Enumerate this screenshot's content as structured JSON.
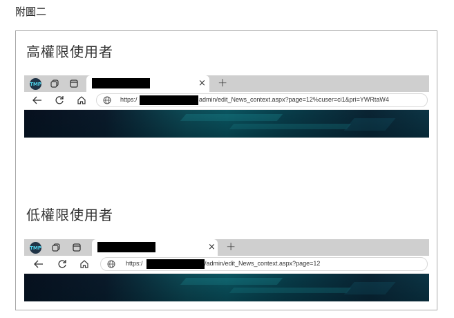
{
  "caption": "附圖二",
  "sections": [
    {
      "title": "高權限使用者",
      "browser": {
        "new_tab_symbol": "+",
        "close_symbol": "×",
        "url_prefix": "https:/",
        "url_suffix": "admin/edit_News_context.aspx?page=12%cuser=ci1&pri=YWRtaW4"
      }
    },
    {
      "title": "低權限使用者",
      "browser": {
        "new_tab_symbol": "+",
        "close_symbol": "×",
        "url_prefix": "https:/",
        "url_suffix": "/admin/edit_News_context.aspx?page=12"
      }
    }
  ],
  "icons": {
    "site_logo": "site-logo-icon",
    "workspaces": "workspaces-icon",
    "tab_actions": "tab-actions-icon",
    "back": "back-arrow-icon",
    "refresh": "refresh-icon",
    "home": "home-icon",
    "globe": "globe-icon"
  },
  "logo_text": "TMP",
  "colors": {
    "tabbar": "#cfcfcf",
    "banner_dark": "#07101e",
    "banner_teal": "#0a5560",
    "redaction": "#000000"
  }
}
